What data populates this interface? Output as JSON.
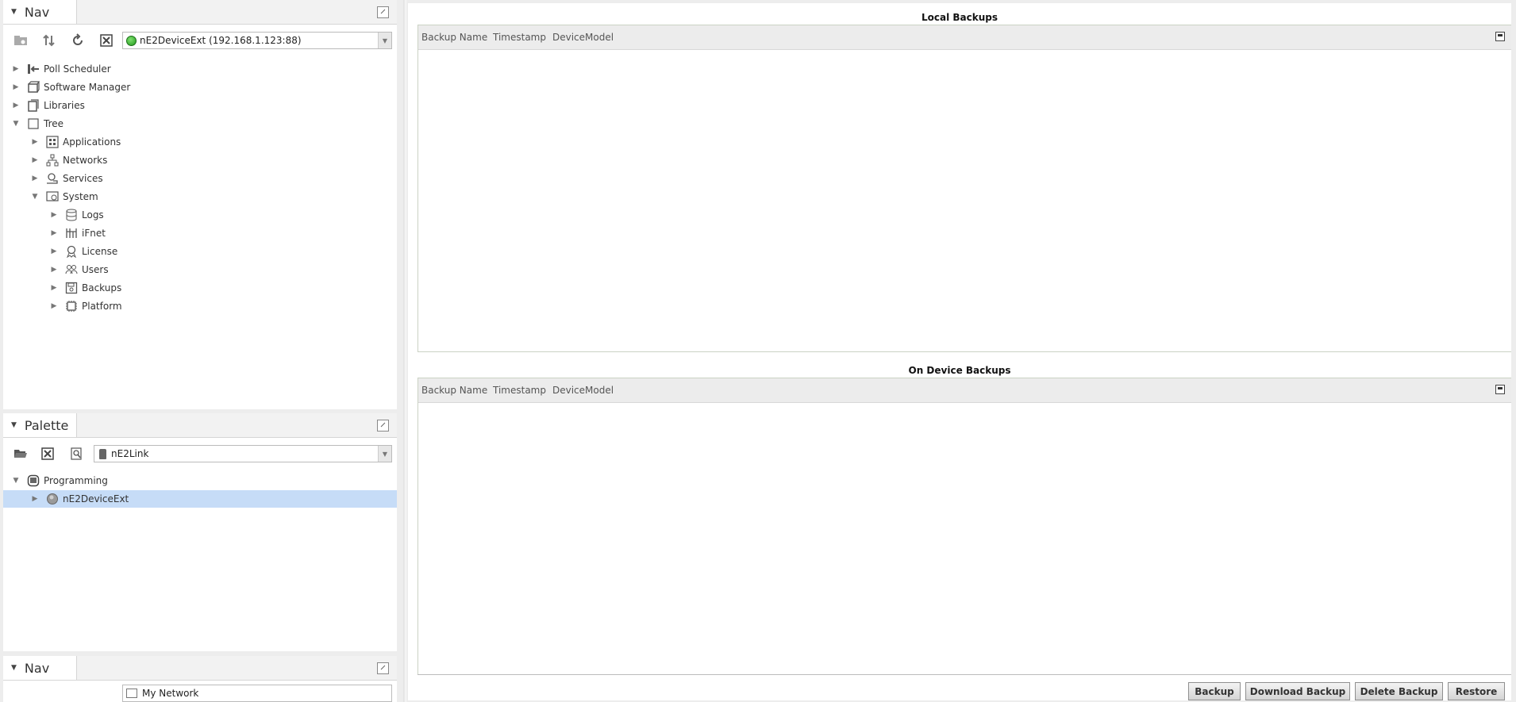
{
  "nav_panel": {
    "title": "Nav",
    "station_selector": "nE2DeviceExt (192.168.1.123:88)",
    "tree": [
      {
        "label": "Poll Scheduler",
        "icon": "poll-scheduler-icon",
        "expanded": false
      },
      {
        "label": "Software Manager",
        "icon": "software-manager-icon",
        "expanded": false
      },
      {
        "label": "Libraries",
        "icon": "libraries-icon",
        "expanded": false
      },
      {
        "label": "Tree",
        "icon": "tree-icon",
        "expanded": true
      },
      {
        "label": "Applications",
        "icon": "applications-icon",
        "expanded": false
      },
      {
        "label": "Networks",
        "icon": "networks-icon",
        "expanded": false
      },
      {
        "label": "Services",
        "icon": "services-icon",
        "expanded": false
      },
      {
        "label": "System",
        "icon": "system-icon",
        "expanded": true
      },
      {
        "label": "Logs",
        "icon": "logs-icon",
        "expanded": false
      },
      {
        "label": "iFnet",
        "icon": "ifnet-icon",
        "expanded": false
      },
      {
        "label": "License",
        "icon": "license-icon",
        "expanded": false
      },
      {
        "label": "Users",
        "icon": "users-icon",
        "expanded": false
      },
      {
        "label": "Backups",
        "icon": "backups-icon",
        "expanded": false
      },
      {
        "label": "Platform",
        "icon": "platform-icon",
        "expanded": false
      }
    ]
  },
  "palette_panel": {
    "title": "Palette",
    "module_selector": "nE2Link",
    "tree": [
      {
        "label": "Programming",
        "icon": "programming-icon",
        "expanded": true
      },
      {
        "label": "nE2DeviceExt",
        "icon": "device-ext-icon",
        "expanded": false,
        "selected": true
      }
    ]
  },
  "nav_panel_2": {
    "title": "Nav",
    "selector_partial": "My Network"
  },
  "main": {
    "local_backups": {
      "title": "Local Backups",
      "columns": [
        "Backup Name",
        "Timestamp",
        "DeviceModel"
      ],
      "rows": []
    },
    "on_device_backups": {
      "title": "On Device Backups",
      "columns": [
        "Backup Name",
        "Timestamp",
        "DeviceModel"
      ],
      "rows": []
    },
    "buttons": {
      "backup": "Backup",
      "download_backup": "Download Backup",
      "delete_backup": "Delete Backup",
      "restore": "Restore"
    }
  },
  "colors": {
    "selection": "#c6dcf7",
    "status_ok": "#2aa52a"
  }
}
